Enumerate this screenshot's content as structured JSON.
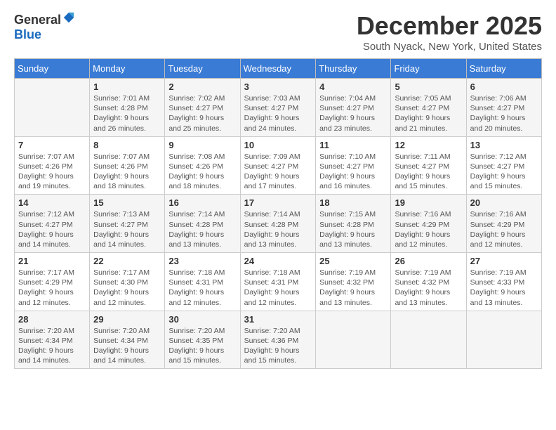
{
  "header": {
    "logo_general": "General",
    "logo_blue": "Blue",
    "title": "December 2025",
    "subtitle": "South Nyack, New York, United States"
  },
  "days_of_week": [
    "Sunday",
    "Monday",
    "Tuesday",
    "Wednesday",
    "Thursday",
    "Friday",
    "Saturday"
  ],
  "weeks": [
    [
      {
        "day": "",
        "sunrise": "",
        "sunset": "",
        "daylight": ""
      },
      {
        "day": "1",
        "sunrise": "Sunrise: 7:01 AM",
        "sunset": "Sunset: 4:28 PM",
        "daylight": "Daylight: 9 hours and 26 minutes."
      },
      {
        "day": "2",
        "sunrise": "Sunrise: 7:02 AM",
        "sunset": "Sunset: 4:27 PM",
        "daylight": "Daylight: 9 hours and 25 minutes."
      },
      {
        "day": "3",
        "sunrise": "Sunrise: 7:03 AM",
        "sunset": "Sunset: 4:27 PM",
        "daylight": "Daylight: 9 hours and 24 minutes."
      },
      {
        "day": "4",
        "sunrise": "Sunrise: 7:04 AM",
        "sunset": "Sunset: 4:27 PM",
        "daylight": "Daylight: 9 hours and 23 minutes."
      },
      {
        "day": "5",
        "sunrise": "Sunrise: 7:05 AM",
        "sunset": "Sunset: 4:27 PM",
        "daylight": "Daylight: 9 hours and 21 minutes."
      },
      {
        "day": "6",
        "sunrise": "Sunrise: 7:06 AM",
        "sunset": "Sunset: 4:27 PM",
        "daylight": "Daylight: 9 hours and 20 minutes."
      }
    ],
    [
      {
        "day": "7",
        "sunrise": "Sunrise: 7:07 AM",
        "sunset": "Sunset: 4:26 PM",
        "daylight": "Daylight: 9 hours and 19 minutes."
      },
      {
        "day": "8",
        "sunrise": "Sunrise: 7:07 AM",
        "sunset": "Sunset: 4:26 PM",
        "daylight": "Daylight: 9 hours and 18 minutes."
      },
      {
        "day": "9",
        "sunrise": "Sunrise: 7:08 AM",
        "sunset": "Sunset: 4:26 PM",
        "daylight": "Daylight: 9 hours and 18 minutes."
      },
      {
        "day": "10",
        "sunrise": "Sunrise: 7:09 AM",
        "sunset": "Sunset: 4:27 PM",
        "daylight": "Daylight: 9 hours and 17 minutes."
      },
      {
        "day": "11",
        "sunrise": "Sunrise: 7:10 AM",
        "sunset": "Sunset: 4:27 PM",
        "daylight": "Daylight: 9 hours and 16 minutes."
      },
      {
        "day": "12",
        "sunrise": "Sunrise: 7:11 AM",
        "sunset": "Sunset: 4:27 PM",
        "daylight": "Daylight: 9 hours and 15 minutes."
      },
      {
        "day": "13",
        "sunrise": "Sunrise: 7:12 AM",
        "sunset": "Sunset: 4:27 PM",
        "daylight": "Daylight: 9 hours and 15 minutes."
      }
    ],
    [
      {
        "day": "14",
        "sunrise": "Sunrise: 7:12 AM",
        "sunset": "Sunset: 4:27 PM",
        "daylight": "Daylight: 9 hours and 14 minutes."
      },
      {
        "day": "15",
        "sunrise": "Sunrise: 7:13 AM",
        "sunset": "Sunset: 4:27 PM",
        "daylight": "Daylight: 9 hours and 14 minutes."
      },
      {
        "day": "16",
        "sunrise": "Sunrise: 7:14 AM",
        "sunset": "Sunset: 4:28 PM",
        "daylight": "Daylight: 9 hours and 13 minutes."
      },
      {
        "day": "17",
        "sunrise": "Sunrise: 7:14 AM",
        "sunset": "Sunset: 4:28 PM",
        "daylight": "Daylight: 9 hours and 13 minutes."
      },
      {
        "day": "18",
        "sunrise": "Sunrise: 7:15 AM",
        "sunset": "Sunset: 4:28 PM",
        "daylight": "Daylight: 9 hours and 13 minutes."
      },
      {
        "day": "19",
        "sunrise": "Sunrise: 7:16 AM",
        "sunset": "Sunset: 4:29 PM",
        "daylight": "Daylight: 9 hours and 12 minutes."
      },
      {
        "day": "20",
        "sunrise": "Sunrise: 7:16 AM",
        "sunset": "Sunset: 4:29 PM",
        "daylight": "Daylight: 9 hours and 12 minutes."
      }
    ],
    [
      {
        "day": "21",
        "sunrise": "Sunrise: 7:17 AM",
        "sunset": "Sunset: 4:29 PM",
        "daylight": "Daylight: 9 hours and 12 minutes."
      },
      {
        "day": "22",
        "sunrise": "Sunrise: 7:17 AM",
        "sunset": "Sunset: 4:30 PM",
        "daylight": "Daylight: 9 hours and 12 minutes."
      },
      {
        "day": "23",
        "sunrise": "Sunrise: 7:18 AM",
        "sunset": "Sunset: 4:31 PM",
        "daylight": "Daylight: 9 hours and 12 minutes."
      },
      {
        "day": "24",
        "sunrise": "Sunrise: 7:18 AM",
        "sunset": "Sunset: 4:31 PM",
        "daylight": "Daylight: 9 hours and 12 minutes."
      },
      {
        "day": "25",
        "sunrise": "Sunrise: 7:19 AM",
        "sunset": "Sunset: 4:32 PM",
        "daylight": "Daylight: 9 hours and 13 minutes."
      },
      {
        "day": "26",
        "sunrise": "Sunrise: 7:19 AM",
        "sunset": "Sunset: 4:32 PM",
        "daylight": "Daylight: 9 hours and 13 minutes."
      },
      {
        "day": "27",
        "sunrise": "Sunrise: 7:19 AM",
        "sunset": "Sunset: 4:33 PM",
        "daylight": "Daylight: 9 hours and 13 minutes."
      }
    ],
    [
      {
        "day": "28",
        "sunrise": "Sunrise: 7:20 AM",
        "sunset": "Sunset: 4:34 PM",
        "daylight": "Daylight: 9 hours and 14 minutes."
      },
      {
        "day": "29",
        "sunrise": "Sunrise: 7:20 AM",
        "sunset": "Sunset: 4:34 PM",
        "daylight": "Daylight: 9 hours and 14 minutes."
      },
      {
        "day": "30",
        "sunrise": "Sunrise: 7:20 AM",
        "sunset": "Sunset: 4:35 PM",
        "daylight": "Daylight: 9 hours and 15 minutes."
      },
      {
        "day": "31",
        "sunrise": "Sunrise: 7:20 AM",
        "sunset": "Sunset: 4:36 PM",
        "daylight": "Daylight: 9 hours and 15 minutes."
      },
      {
        "day": "",
        "sunrise": "",
        "sunset": "",
        "daylight": ""
      },
      {
        "day": "",
        "sunrise": "",
        "sunset": "",
        "daylight": ""
      },
      {
        "day": "",
        "sunrise": "",
        "sunset": "",
        "daylight": ""
      }
    ]
  ]
}
